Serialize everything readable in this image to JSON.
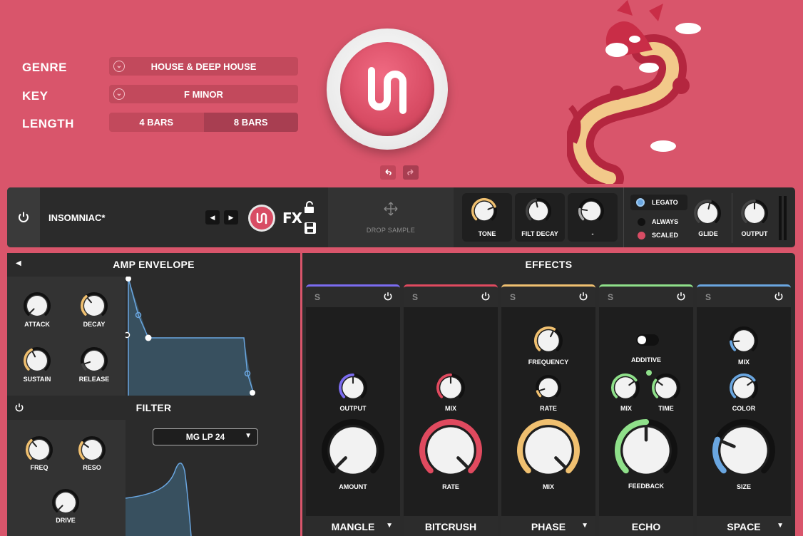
{
  "header": {
    "genre_label": "GENRE",
    "genre_value": "HOUSE & DEEP HOUSE",
    "key_label": "KEY",
    "key_value": "F MINOR",
    "length_label": "LENGTH",
    "length_options": [
      "4 BARS",
      "8 BARS"
    ],
    "length_selected": "8 BARS"
  },
  "colors": {
    "background": "#d9556b",
    "panel": "#2b2b2b",
    "accent_purple": "#7b6cf0",
    "accent_red": "#e04a5f",
    "accent_yellow": "#f0c070",
    "accent_green": "#8fe08a",
    "accent_blue": "#6aa6e0"
  },
  "mainbar": {
    "preset_name": "INSOMNIAC*",
    "fx_label": "FX",
    "drop_sample": "DROP SAMPLE",
    "knobs": [
      {
        "label": "TONE",
        "value": 0.75
      },
      {
        "label": "FILT DECAY",
        "value": 0.45
      },
      {
        "label": "-",
        "value": 0.2
      }
    ],
    "modes": [
      "LEGATO",
      "ALWAYS",
      "SCALED"
    ],
    "glide_label": "GLIDE",
    "output_label": "OUTPUT"
  },
  "amp": {
    "title": "AMP ENVELOPE",
    "knobs": [
      {
        "label": "ATTACK",
        "value": 0.0
      },
      {
        "label": "DECAY",
        "value": 0.35
      },
      {
        "label": "SUSTAIN",
        "value": 0.4
      },
      {
        "label": "RELEASE",
        "value": 0.1
      }
    ]
  },
  "filter": {
    "title": "FILTER",
    "type": "MG LP 24",
    "knobs": [
      {
        "label": "FREQ",
        "value": 0.35
      },
      {
        "label": "RESO",
        "value": 0.3
      },
      {
        "label": "DRIVE",
        "value": 0.0
      }
    ]
  },
  "effects": {
    "title": "EFFECTS",
    "solo": "S",
    "modules": [
      {
        "name": "MANGLE",
        "has_dropdown": true,
        "color": "#7b6cf0",
        "knobs": [
          {
            "label": "OUTPUT",
            "value": 0.5
          },
          {
            "label": "AMOUNT",
            "value": 0.0
          }
        ]
      },
      {
        "name": "BITCRUSH",
        "has_dropdown": false,
        "color": "#e04a5f",
        "knobs": [
          {
            "label": "MIX",
            "value": 0.5
          },
          {
            "label": "RATE",
            "value": 1.0
          }
        ]
      },
      {
        "name": "PHASE",
        "has_dropdown": true,
        "color": "#f0c070",
        "knobs": [
          {
            "label": "FREQUENCY",
            "value": 0.6
          },
          {
            "label": "RATE",
            "value": 0.1
          },
          {
            "label": "MIX",
            "value": 1.0
          }
        ]
      },
      {
        "name": "ECHO",
        "has_dropdown": false,
        "color": "#8fe08a",
        "toggle_label": "ADDITIVE",
        "knobs": [
          {
            "label": "MIX",
            "value": 0.7
          },
          {
            "label": "TIME",
            "value": 0.3
          },
          {
            "label": "FEEDBACK",
            "value": 0.5
          }
        ]
      },
      {
        "name": "SPACE",
        "has_dropdown": true,
        "color": "#6aa6e0",
        "knobs": [
          {
            "label": "MIX",
            "value": 0.15
          },
          {
            "label": "COLOR",
            "value": 0.7
          },
          {
            "label": "SIZE",
            "value": 0.25
          }
        ]
      }
    ]
  }
}
